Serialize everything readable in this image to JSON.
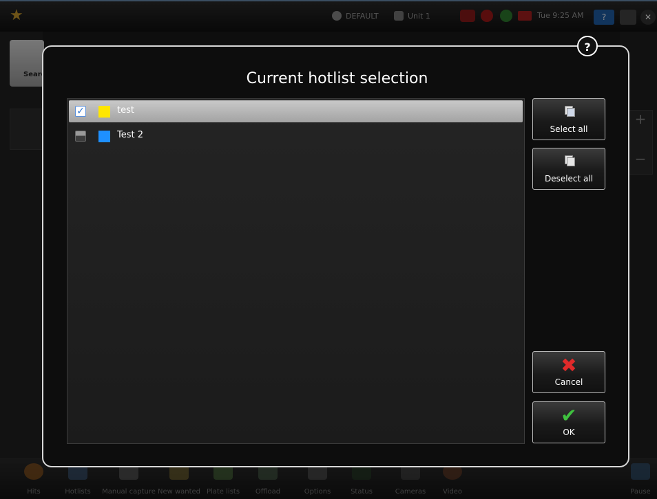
{
  "topbar": {
    "profile": "DEFAULT",
    "unit": "Unit 1",
    "time": "Tue 9:25 AM",
    "help_label": "?"
  },
  "left": {
    "search_label": "Searc"
  },
  "bottom": {
    "items": [
      {
        "label": "Hits",
        "icon": "hits-icon",
        "color": "#c8721c"
      },
      {
        "label": "Hotlists",
        "icon": "hotlists-icon",
        "color": "#4a6fa0"
      },
      {
        "label": "Manual capture",
        "icon": "manual-capture-icon",
        "color": "#7a7a7a"
      },
      {
        "label": "New wanted",
        "icon": "new-wanted-icon",
        "color": "#a08a3a"
      },
      {
        "label": "Plate lists",
        "icon": "plate-lists-icon",
        "color": "#5f8f4a"
      },
      {
        "label": "Offload",
        "icon": "offload-icon",
        "color": "#5a7a5a"
      },
      {
        "label": "Options",
        "icon": "options-icon",
        "color": "#6a6a6a"
      },
      {
        "label": "Status",
        "icon": "status-icon",
        "color": "#2a4a2a"
      },
      {
        "label": "Cameras",
        "icon": "cameras-icon",
        "color": "#555555"
      },
      {
        "label": "Video",
        "icon": "video-icon",
        "color": "#8a4a2a"
      },
      {
        "label": "Pause",
        "icon": "pause-icon",
        "color": "#3a6a9a"
      }
    ]
  },
  "dialog": {
    "title": "Current hotlist selection",
    "help": "?",
    "hotlists": [
      {
        "name": "test",
        "checked": true,
        "color": "#ffe600",
        "selected": true
      },
      {
        "name": "Test 2",
        "checked": false,
        "color": "#1e90ff",
        "selected": false
      }
    ],
    "buttons": {
      "select_all": "Select all",
      "deselect_all": "Deselect all",
      "cancel": "Cancel",
      "ok": "OK"
    }
  }
}
